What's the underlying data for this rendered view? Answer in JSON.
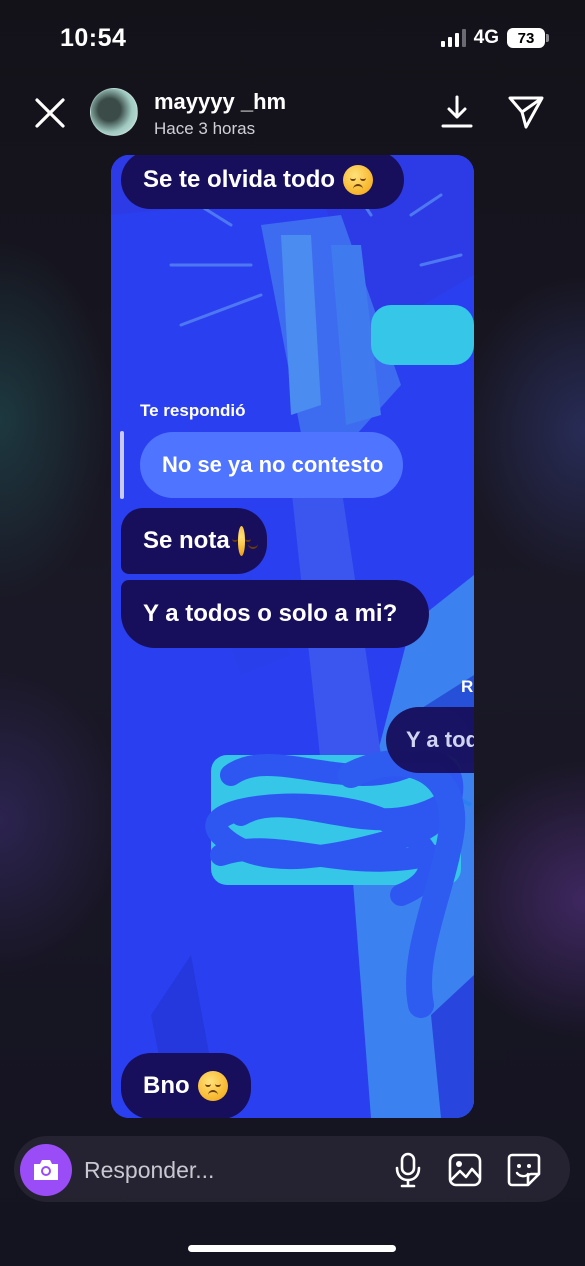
{
  "status_bar": {
    "time": "10:54",
    "network": "4G",
    "battery": "73"
  },
  "header": {
    "username": "mayyyy _hm",
    "time_ago": "Hace 3 horas"
  },
  "story": {
    "messages": [
      {
        "text": "Se te olvida todo",
        "emoji": "disappointed-face-emoji"
      },
      {
        "text": "Se nota",
        "emoji": "relieved-face-emoji"
      },
      {
        "text": "Y a todos o solo a mi?"
      },
      {
        "text": "Bno",
        "emoji": "disappointed-face-emoji"
      }
    ],
    "reply_label": "Te respondió",
    "reply_text": "No se ya no contesto",
    "partial_label": "R",
    "partial_text": "Y a tod"
  },
  "reply": {
    "placeholder": "Responder..."
  },
  "colors": {
    "accent": "#9a4cf7",
    "bubble": "#170f5c",
    "story_bg": "#2a40f0"
  }
}
